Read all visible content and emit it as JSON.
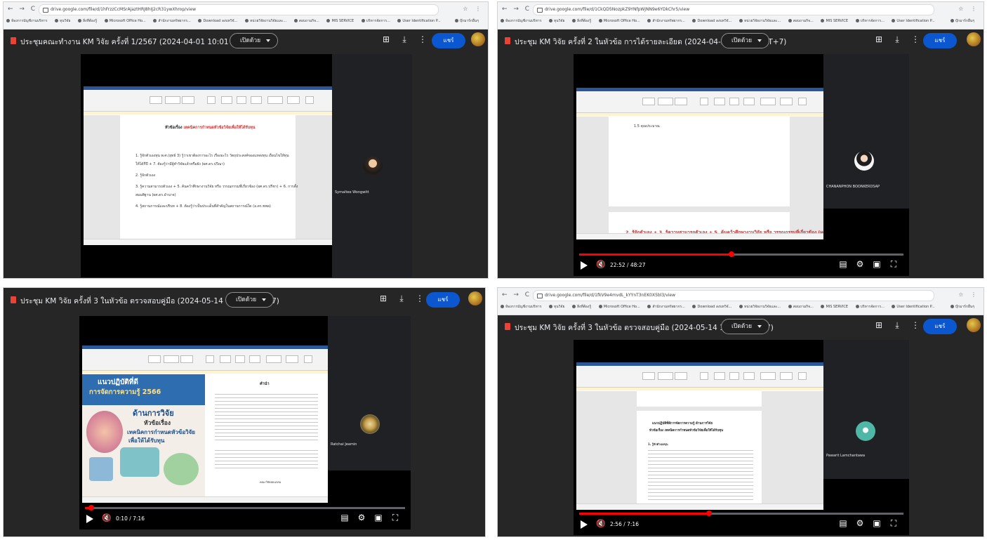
{
  "panels": [
    {
      "browser": {
        "url": "drive.google.com/file/d/1hFrzzCcMSrAjaztHRJ8hIJ2cR31ywXhrop/view",
        "bookmarks": [
          "ห้องการบัญชีงานบริหาร",
          "ทุนวิจัย",
          "สิ่งที่ต้องรู้",
          "Microsoft Office Ho...",
          "สำนักงานทรัพยากร...",
          "Download ลงบทวิจั...",
          "หน่วยวิจัยงานวิจัยและ...",
          "สอบถามกิจ...",
          "MIS SERVICE",
          "บริหารจัดการ...",
          "User Identification P...",
          "หน้าหลัก | ระบบหอ..."
        ],
        "bookmarks_folder": "บุ๊กมาร์กอื่นๆ"
      },
      "title": "ประชุมคณะทำงาน KM วิจัย ครั้งที่ 1/2567 (2024-04-01 10:01 GMT+7)",
      "open_with": "เปิดด้วย",
      "share": "แชร์",
      "doc": {
        "heading_prefix": "หัวข้อเรื่อง",
        "heading_highlight": "เทคนิคการกำหนดหัวข้อวิจัยเพื่อให้ได้รับทุน",
        "lines": [
          "1. รู้จักตัวเองทุน พ.ศ.(ยุทธ์ 3) รู้ว่าเขาต้องการอะไร เรื่องอะไร วัตถุประสงค์ของแหล่งทุน เงื่อนไขให้ทุน",
          "ให้ได้กี่ปี + 7. ต้องรู้ว่ามีผู้ทำวิจัยแล้วหรือยัง (ผศ.ดร.ปวีณา)",
          "2. รู้จักตัวเอง",
          "3. รู้ความสามารถตัวเอง + 5. ค้นคว้าศึกษางานวิจัย หรือ วรรณกรรมที่เกี่ยวข้อง (ผศ.ดร.ปรีชา) + 6. การตั้ง",
          "สมมติฐาน (ผศ.ดร.อำนาจ)",
          "4. รู้สถานการณ์และปริบท + 8. ต้องรู้ว่าเป็นประเด็นที่สำคัญในสถานการณ์ใด (อ.ดร.ชพล)"
        ]
      },
      "participant": "Symaltee Wongwitt"
    },
    {
      "browser": {
        "url": "drive.google.com/file/d/1CkQD5NozpkZ9YNfpWjNN9e6YDkChr5/view",
        "bookmarks": [
          "ห้องการบัญชีงานบริหาร",
          "ทุนวิจัย",
          "สิ่งที่ต้องรู้",
          "Microsoft Office Ho...",
          "สำนักงานทรัพยากร...",
          "Download ลงบทวิจั...",
          "หน่วยวิจัยงานวิจัยและ...",
          "สอบถามกิจ...",
          "MIS SERVICE",
          "บริหารจัดการ...",
          "User Identification P...",
          "หน้าหลัก | ระบบหอ..."
        ],
        "bookmarks_folder": "บุ๊กมาร์กอื่นๆ"
      },
      "title": "ประชุม KM วิจัย ครั้งที่ 2 ในหัวข้อ การได้รายละเอียด (2024-04-24 10:04 GMT+7)",
      "open_with": "เปิดด้วย",
      "share": "แชร์",
      "doc": {
        "line1": "1.5 คุณประมาณ",
        "line2": "2. รู้จักตัวเอง + 3. รู้ความสามารถตัวเอง + 5. ค้นคว้าศึกษางานวิจัย หรือ วรรณกรรมที่เกี่ยวข้อง (ผศ.ดร."
      },
      "participant": "CHANANPHON BOONKERDSAP",
      "time": "22:52 / 48:27",
      "progress": 0.47
    },
    {
      "title": "ประชุม KM วิจัย ครั้งที่ 3 ในหัวข้อ ตรวจสอบคู่มือ (2024-05-14 13:37 GMT+7)",
      "open_with": "เปิดด้วย",
      "share": "แชร์",
      "cover": {
        "line1": "แนวปฏิบัติที่ดี",
        "line2": "การจัดการความรู้ 2566",
        "line3": "ด้านการวิจัย",
        "line4": "หัวข้อเรื่อง",
        "line5": "เทคนิคการกำหนดหัวข้อวิจัย",
        "line6": "เพื่อให้ได้รับทุน"
      },
      "doc": {
        "heading": "คำนำ",
        "signoff": "คณะวิจัยอ่อนรสม"
      },
      "participant": "Ratchai Jeamin",
      "time": "0:10 / 7:16",
      "progress": 0.02
    },
    {
      "browser": {
        "url": "drive.google.com/file/d/1fkV9e4mvdL_kYYnT3nEK0X5bl3/view",
        "bookmarks": [
          "ห้องการบัญชีงานบริหาร",
          "ทุนวิจัย",
          "สิ่งที่ต้องรู้",
          "Microsoft Office Ho...",
          "สำนักงานทรัพยากร...",
          "Download ลงบทวิจั...",
          "หน่วยวิจัยงานวิจัยและ...",
          "สอบถามกิจ...",
          "MIS SERVICE",
          "บริหารจัดการ...",
          "User Identification P...",
          "หน้าหลัก | ระบบหอ..."
        ],
        "bookmarks_folder": "บุ๊กมาร์กอื่นๆ"
      },
      "title": "ประชุม KM วิจัย ครั้งที่ 3 ในหัวข้อ ตรวจสอบคู่มือ (2024-05-14 13:37 GMT+7)",
      "open_with": "เปิดด้วย",
      "share": "แชร์",
      "doc": {
        "heading1": "แนวปฏิบัติที่ดีการจัดการความรู้ ด้านการวิจัย",
        "heading2": "หัวข้อเรื่อง เทคนิคการกำหนดหัวข้อวิจัยเพื่อให้ได้รับทุน",
        "sub": "1. รู้จักตัวเองทุน"
      },
      "participant": "Pawarit Lamchantawa",
      "time": "2:56 / 7:16",
      "progress": 0.4
    }
  ]
}
